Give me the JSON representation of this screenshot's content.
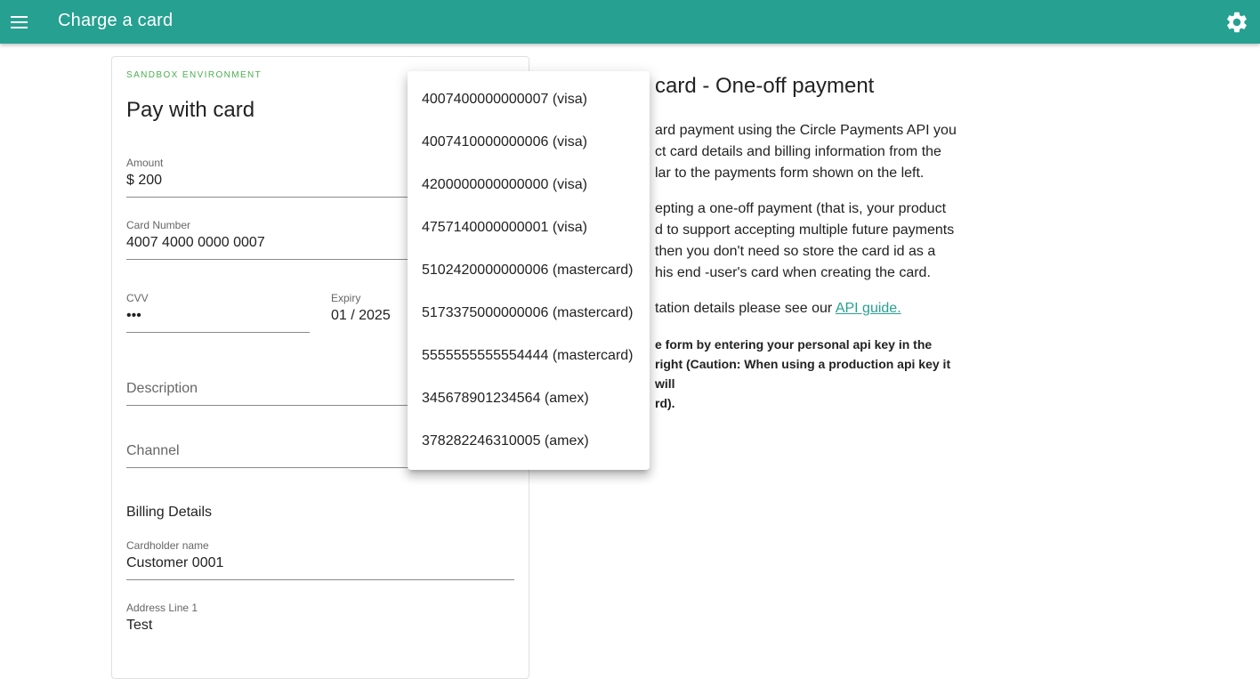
{
  "app_bar": {
    "title": "Charge a card",
    "menu_icon": "menu-icon",
    "settings_icon": "gear-icon",
    "color": "#26a091"
  },
  "form": {
    "environment": "SANDBOX ENVIRONMENT",
    "title": "Pay with card",
    "amount": {
      "label": "Amount",
      "value": "$ 200"
    },
    "card_number": {
      "label": "Card Number",
      "value": "4007 4000 0000 0007"
    },
    "cvv": {
      "label": "CVV",
      "value": "•••"
    },
    "expiry": {
      "label": "Expiry",
      "value": "01 / 2025"
    },
    "description": {
      "placeholder": "Description"
    },
    "channel": {
      "placeholder": "Channel"
    },
    "billing_title": "Billing Details",
    "cardholder": {
      "label": "Cardholder name",
      "value": "Customer 0001"
    },
    "address1": {
      "label": "Address Line 1",
      "value": "Test"
    }
  },
  "card_options": [
    "4007400000000007 (visa)",
    "4007410000000006 (visa)",
    "4200000000000000 (visa)",
    "4757140000000001 (visa)",
    "5102420000000006 (mastercard)",
    "5173375000000006 (mastercard)",
    "5555555555554444 (mastercard)",
    "345678901234564 (amex)",
    "378282246310005 (amex)"
  ],
  "info": {
    "title_visible": "card - One-off payment",
    "p1": [
      "ard payment using the Circle Payments API you",
      "ct card details and billing information from the",
      "lar to the payments form shown on the left."
    ],
    "p2": [
      "epting a one-off payment (that is, your product",
      "d to support accepting multiple future payments",
      "then you don't need so store the card id as a",
      "his end -user's card when creating the card."
    ],
    "p3_text": "tation details please see our ",
    "p3_link": "API guide.",
    "note": [
      "e form by entering your personal api key in the",
      "right (Caution: When using a production api key it will",
      "rd)."
    ]
  }
}
